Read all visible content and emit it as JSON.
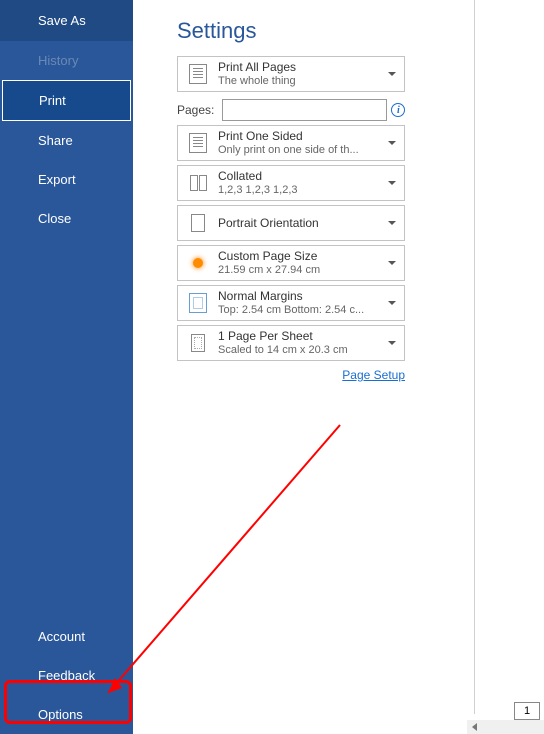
{
  "sidebar": {
    "items_top": [
      {
        "label": "Save As",
        "class": "saveas"
      },
      {
        "label": "History",
        "class": "dim"
      },
      {
        "label": "Print",
        "class": "selected"
      },
      {
        "label": "Share",
        "class": ""
      },
      {
        "label": "Export",
        "class": ""
      },
      {
        "label": "Close",
        "class": ""
      }
    ],
    "items_bottom": [
      {
        "label": "Account"
      },
      {
        "label": "Feedback"
      },
      {
        "label": "Options"
      }
    ]
  },
  "settings": {
    "title": "Settings",
    "pages_label": "Pages:",
    "pages_value": "",
    "rows": [
      {
        "line1": "Print All Pages",
        "line2": "The whole thing",
        "icon": "pages-icon"
      },
      {
        "line1": "Print One Sided",
        "line2": "Only print on one side of th...",
        "icon": "onesided-icon"
      },
      {
        "line1": "Collated",
        "line2": "1,2,3    1,2,3    1,2,3",
        "icon": "collated-icon"
      },
      {
        "line1": "Portrait Orientation",
        "line2": "",
        "icon": "portrait-icon"
      },
      {
        "line1": "Custom Page Size",
        "line2": "21.59 cm x 27.94 cm",
        "icon": "custom-icon"
      },
      {
        "line1": "Normal Margins",
        "line2": "Top: 2.54 cm Bottom: 2.54 c...",
        "icon": "margins-icon"
      },
      {
        "line1": "1 Page Per Sheet",
        "line2": "Scaled to 14 cm x 20.3 cm",
        "icon": "sheet-icon"
      }
    ],
    "page_setup": "Page Setup"
  },
  "page_number": "1"
}
